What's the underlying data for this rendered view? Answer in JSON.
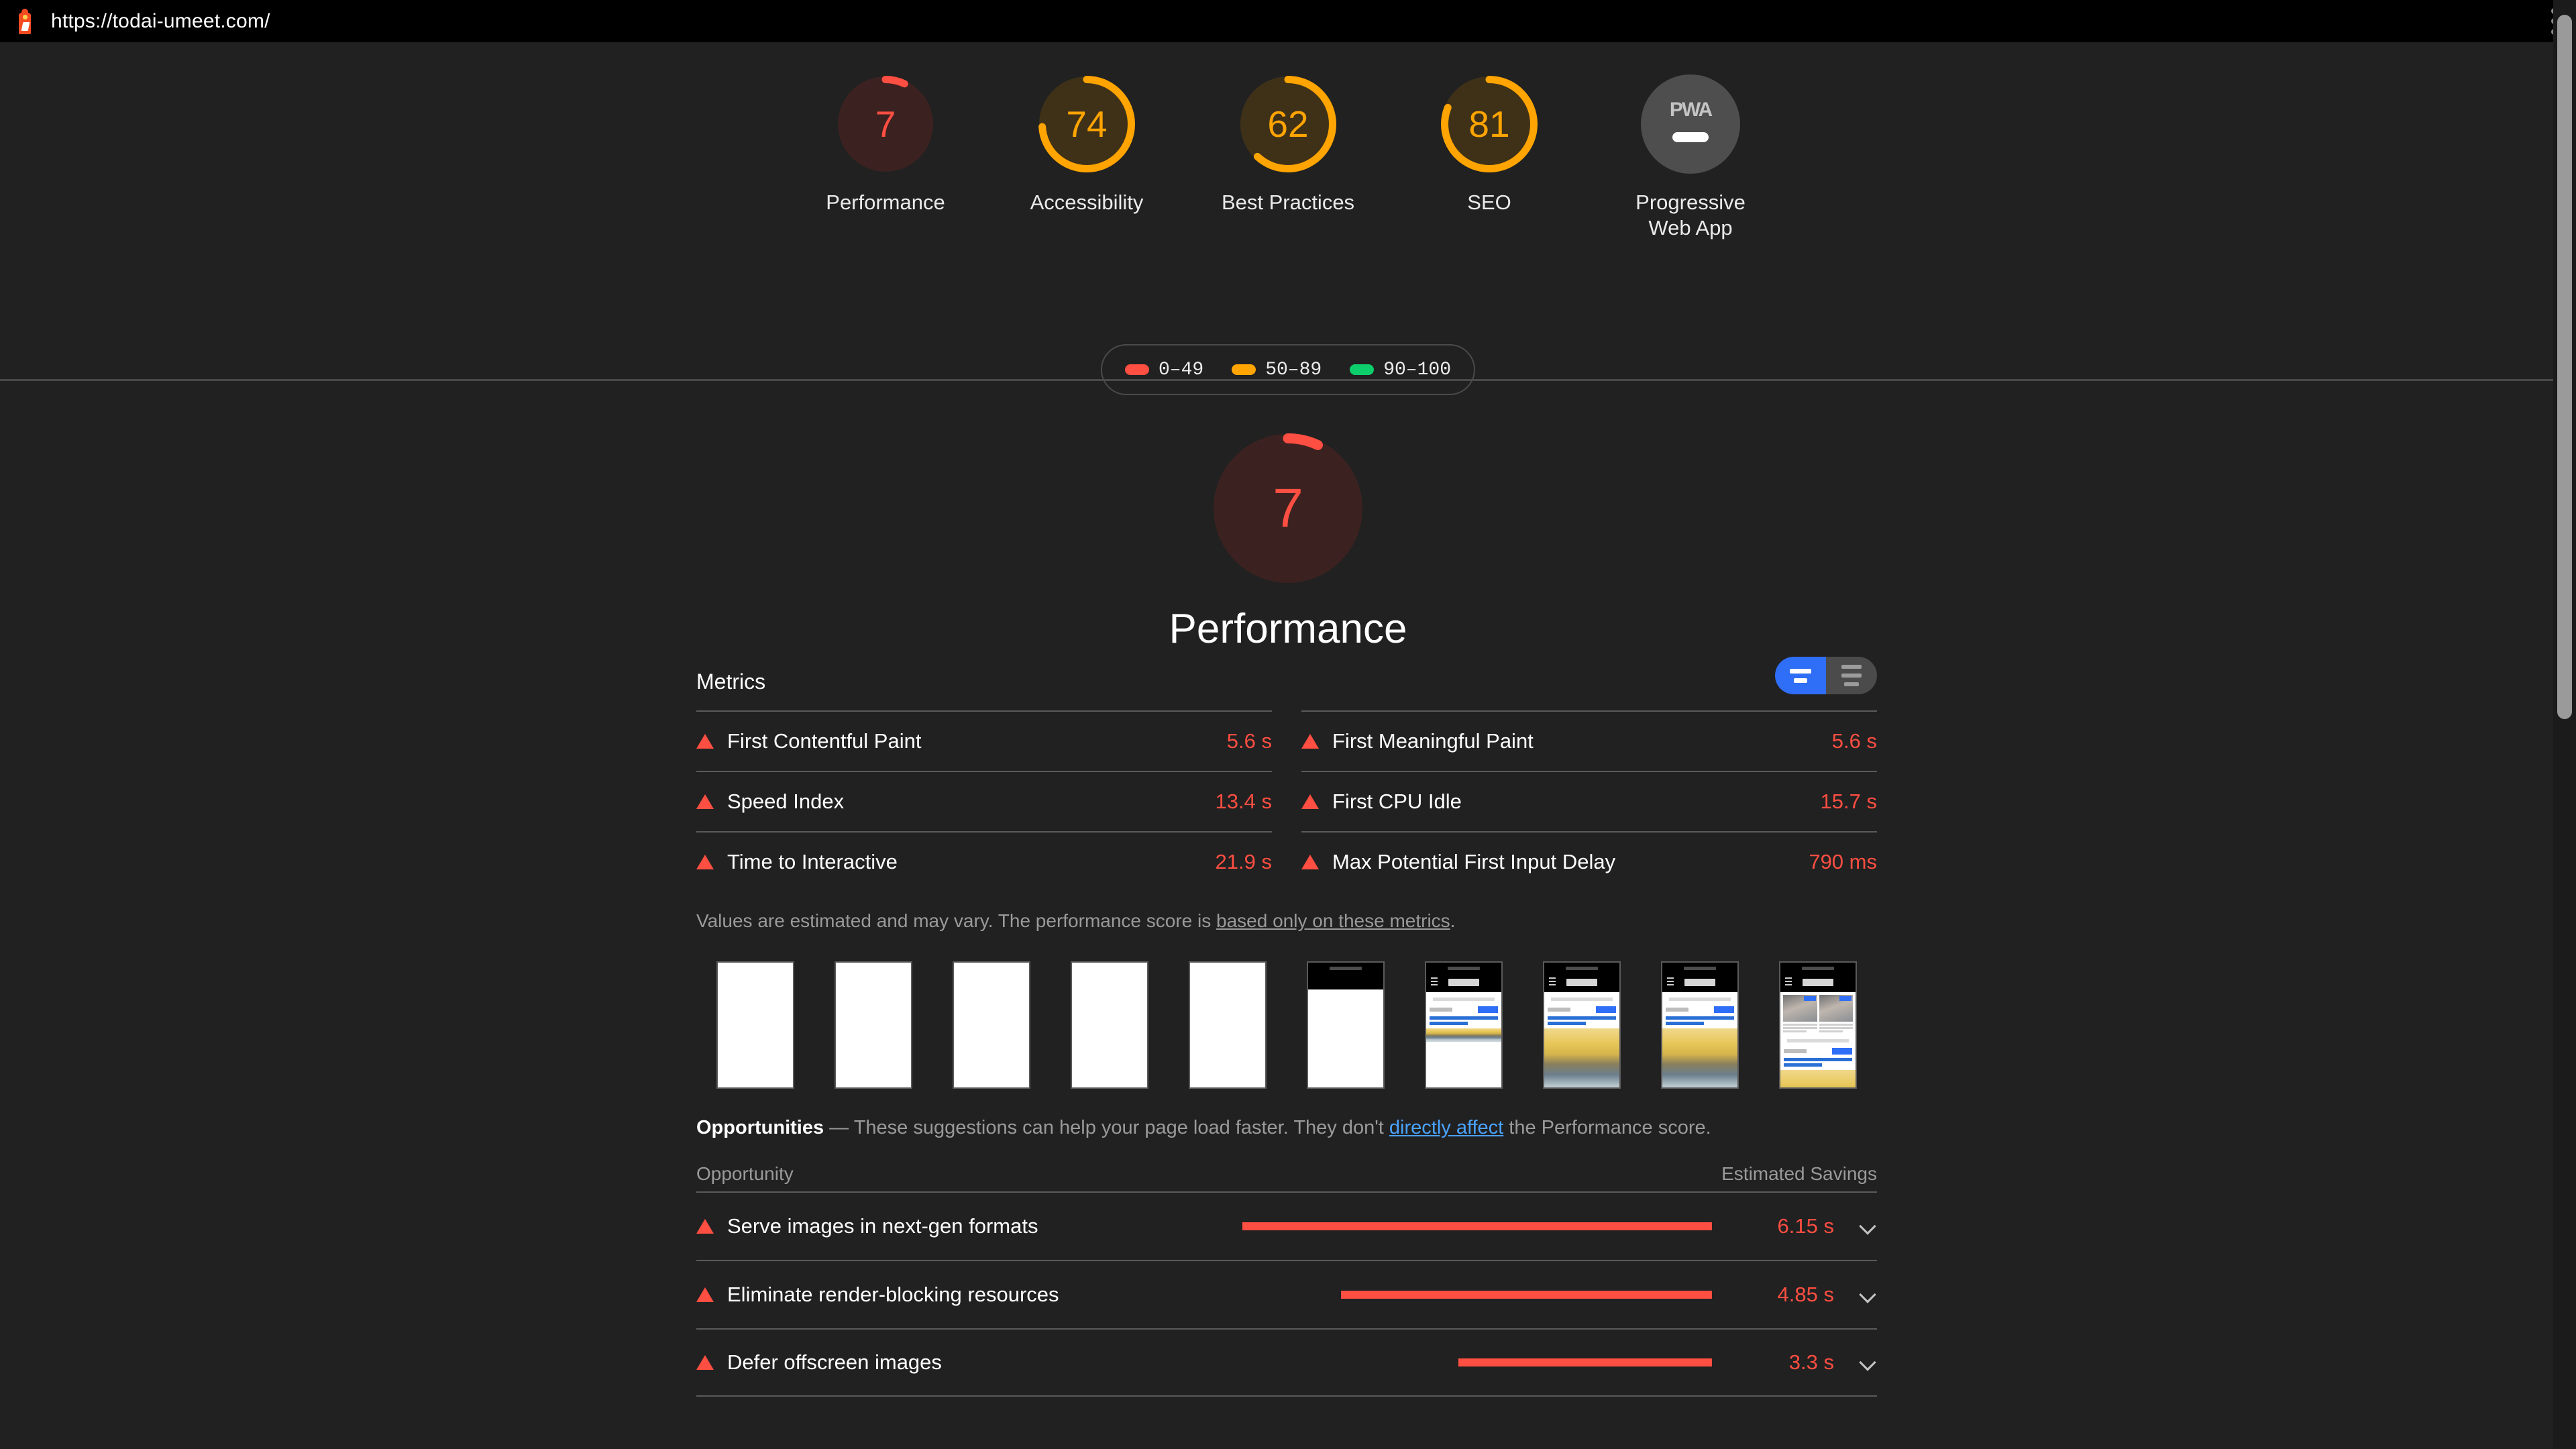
{
  "browser": {
    "url": "https://todai-umeet.com/",
    "logo_icon": "lighthouse-icon",
    "menu_icon": "kebab-menu-icon"
  },
  "scores": {
    "items": [
      {
        "label": "Performance",
        "value": "7",
        "pct": 7,
        "color": "#ff4e42",
        "track": "#3b2220"
      },
      {
        "label": "Accessibility",
        "value": "74",
        "pct": 74,
        "color": "#ffa400",
        "track": "#3f3118"
      },
      {
        "label": "Best Practices",
        "value": "62",
        "pct": 62,
        "color": "#ffa400",
        "track": "#3f3118"
      },
      {
        "label": "SEO",
        "value": "81",
        "pct": 81,
        "color": "#ffa400",
        "track": "#3f3118"
      },
      {
        "label": "Progressive\nWeb App",
        "value": "PWA",
        "pct": 0,
        "color": "#c4c4c4",
        "track": "#4e4e4e"
      }
    ],
    "pwa_text": "PWA"
  },
  "legend": {
    "items": [
      {
        "range": "0–49",
        "color": "#ff4e42"
      },
      {
        "range": "50–89",
        "color": "#ffa400"
      },
      {
        "range": "90–100",
        "color": "#0cce6b"
      }
    ]
  },
  "hero": {
    "value": "7",
    "title": "Performance",
    "pct": 7,
    "color": "#ff4e42",
    "track": "#3b2220"
  },
  "metrics": {
    "section_title": "Metrics",
    "toggle": {
      "left_name": "simple-view-toggle",
      "right_name": "expanded-view-toggle",
      "active": "left"
    },
    "left_column": [
      {
        "name": "First Contentful Paint",
        "value": "5.6 s",
        "status": "fail"
      },
      {
        "name": "Speed Index",
        "value": "13.4 s",
        "status": "fail"
      },
      {
        "name": "Time to Interactive",
        "value": "21.9 s",
        "status": "fail"
      }
    ],
    "right_column": [
      {
        "name": "First Meaningful Paint",
        "value": "5.6 s",
        "status": "fail"
      },
      {
        "name": "First CPU Idle",
        "value": "15.7 s",
        "status": "fail"
      },
      {
        "name": "Max Potential First Input Delay",
        "value": "790 ms",
        "status": "fail"
      }
    ],
    "disclaimer_pre": "Values are estimated and may vary. The performance score is ",
    "disclaimer_link": "based only on these metrics",
    "disclaimer_post": "."
  },
  "filmstrip": {
    "frames": [
      {
        "state": "blank"
      },
      {
        "state": "blank"
      },
      {
        "state": "blank"
      },
      {
        "state": "blank"
      },
      {
        "state": "blank"
      },
      {
        "state": "header-only"
      },
      {
        "state": "text-partial-photo"
      },
      {
        "state": "text-full-photo"
      },
      {
        "state": "text-full-photo"
      },
      {
        "state": "cards-full-photo"
      }
    ]
  },
  "opportunities": {
    "intro_bold": "Opportunities",
    "intro_pre": " — These suggestions can help your page load faster. They don't ",
    "intro_link": "directly affect",
    "intro_post": " the Performance score.",
    "col_opportunity": "Opportunity",
    "col_savings": "Estimated Savings",
    "rows": [
      {
        "name": "Serve images in next-gen formats",
        "savings": "6.15 s",
        "bar_pct": 100,
        "status": "fail"
      },
      {
        "name": "Eliminate render-blocking resources",
        "savings": "4.85 s",
        "bar_pct": 79,
        "status": "fail"
      },
      {
        "name": "Defer offscreen images",
        "savings": "3.3 s",
        "bar_pct": 54,
        "status": "fail"
      }
    ],
    "chevron_icon": "chevron-down-icon"
  },
  "colors": {
    "fail": "#ff4e42",
    "average": "#ffa400",
    "pass": "#0cce6b",
    "link": "#4aa3ff",
    "accent": "#2f6ef7",
    "background": "#212121",
    "topbar": "#000000"
  }
}
